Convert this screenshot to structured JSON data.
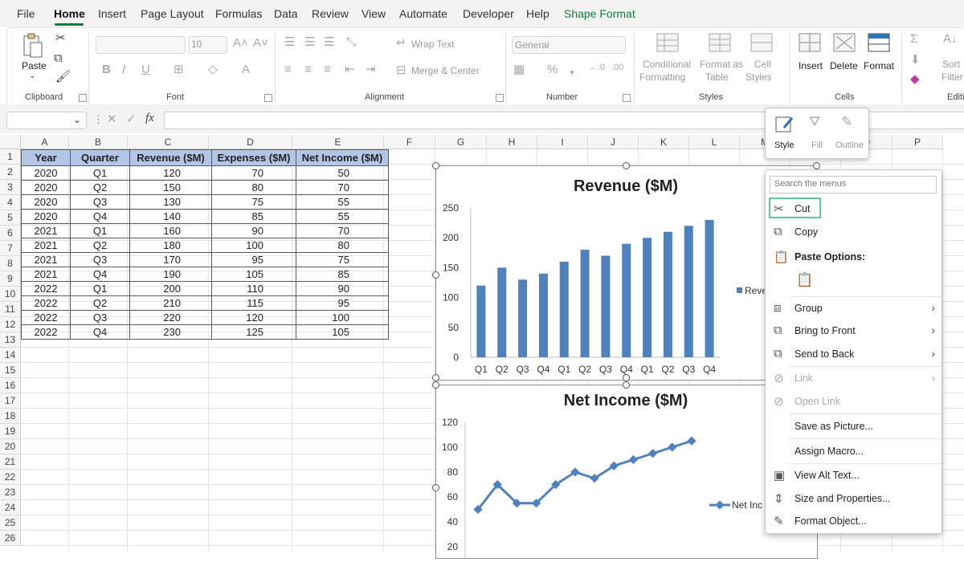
{
  "ribbon_tabs": [
    "File",
    "Home",
    "Insert",
    "Page Layout",
    "Formulas",
    "Data",
    "Review",
    "View",
    "Automate",
    "Developer",
    "Help",
    "Shape Format"
  ],
  "ribbon": {
    "clipboard": {
      "label": "Clipboard",
      "paste": "Paste"
    },
    "font": {
      "label": "Font",
      "size": "10"
    },
    "alignment": {
      "label": "Alignment",
      "wrap": "Wrap Text",
      "merge": "Merge & Center"
    },
    "number": {
      "label": "Number",
      "format": "General"
    },
    "styles": {
      "label": "Styles",
      "conditional_1": "Conditional",
      "conditional_2": "Formatting",
      "format_table_1": "Format as",
      "format_table_2": "Table",
      "cell_styles_1": "Cell",
      "cell_styles_2": "Styles"
    },
    "cells": {
      "label": "Cells",
      "insert": "Insert",
      "delete": "Delete",
      "format": "Format"
    },
    "editing": {
      "label": "Editi",
      "sort": "Sort",
      "filter": "Filter"
    }
  },
  "formula_bar": {
    "fx": "fx",
    "value": ""
  },
  "columns": [
    "A",
    "B",
    "C",
    "D",
    "E",
    "F",
    "G",
    "H",
    "I",
    "J",
    "K",
    "L",
    "M",
    "N",
    "O",
    "P"
  ],
  "rows": [
    "1",
    "2",
    "3",
    "4",
    "5",
    "6",
    "7",
    "8",
    "9",
    "10",
    "11",
    "12",
    "13",
    "14",
    "15",
    "16",
    "17",
    "18",
    "19",
    "20",
    "21",
    "22",
    "23",
    "24",
    "25",
    "26"
  ],
  "table": {
    "headers": [
      "Year",
      "Quarter",
      "Revenue ($M)",
      "Expenses ($M)",
      "Net Income ($M)"
    ],
    "rows": [
      [
        "2020",
        "Q1",
        "120",
        "70",
        "50"
      ],
      [
        "2020",
        "Q2",
        "150",
        "80",
        "70"
      ],
      [
        "2020",
        "Q3",
        "130",
        "75",
        "55"
      ],
      [
        "2020",
        "Q4",
        "140",
        "85",
        "55"
      ],
      [
        "2021",
        "Q1",
        "160",
        "90",
        "70"
      ],
      [
        "2021",
        "Q2",
        "180",
        "100",
        "80"
      ],
      [
        "2021",
        "Q3",
        "170",
        "95",
        "75"
      ],
      [
        "2021",
        "Q4",
        "190",
        "105",
        "85"
      ],
      [
        "2022",
        "Q1",
        "200",
        "110",
        "90"
      ],
      [
        "2022",
        "Q2",
        "210",
        "115",
        "95"
      ],
      [
        "2022",
        "Q3",
        "220",
        "120",
        "100"
      ],
      [
        "2022",
        "Q4",
        "230",
        "125",
        "105"
      ]
    ]
  },
  "style_popup": {
    "style": "Style",
    "fill": "Fill",
    "outline": "Outline"
  },
  "context_menu": {
    "search_placeholder": "Search the menus",
    "cut": "Cut",
    "copy": "Copy",
    "paste_options": "Paste Options:",
    "group": "Group",
    "bring_front": "Bring to Front",
    "send_back": "Send to Back",
    "link": "Link",
    "open_link": "Open Link",
    "save_picture": "Save as Picture...",
    "assign_macro": "Assign Macro...",
    "alt_text": "View Alt Text...",
    "size_props": "Size and Properties...",
    "format_object": "Format Object..."
  },
  "colors": {
    "accent": "#107c41",
    "header_fill": "#b4c6e7",
    "series": "#4f81bd",
    "highlight": "#5ecb9b"
  },
  "chart_data": [
    {
      "type": "bar",
      "title": "Revenue ($M)",
      "categories": [
        "Q1",
        "Q2",
        "Q3",
        "Q4",
        "Q1",
        "Q2",
        "Q3",
        "Q4",
        "Q1",
        "Q2",
        "Q3",
        "Q4"
      ],
      "values": [
        120,
        150,
        130,
        140,
        160,
        180,
        170,
        190,
        200,
        210,
        220,
        230
      ],
      "legend": "Reve",
      "legend_position": "right",
      "ylim": [
        0,
        250
      ],
      "yticks": [
        "0",
        "50",
        "100",
        "150",
        "200",
        "250"
      ],
      "grid": false
    },
    {
      "type": "line",
      "title": "Net Income ($M)",
      "values": [
        50,
        70,
        55,
        55,
        70,
        80,
        75,
        85,
        90,
        95,
        100,
        105
      ],
      "legend": "Net Inc",
      "legend_position": "right",
      "ylim": [
        20,
        120
      ],
      "yticks": [
        "20",
        "40",
        "60",
        "80",
        "100",
        "120"
      ],
      "grid": false
    }
  ]
}
